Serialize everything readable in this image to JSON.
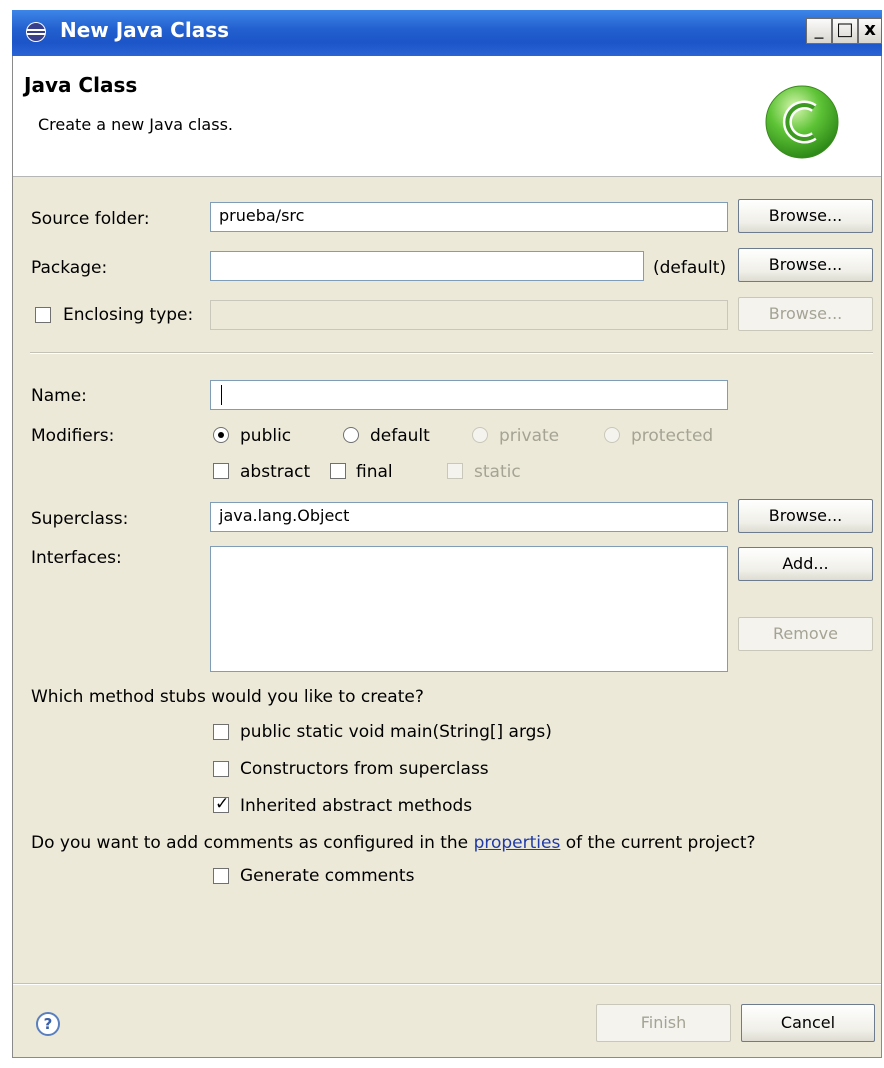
{
  "window": {
    "title": "New Java Class",
    "min": "_",
    "max": "□",
    "close": "x"
  },
  "header": {
    "title": "Java Class",
    "description": "Create a new Java class."
  },
  "form": {
    "source_folder_label": "Source folder:",
    "source_folder_value": "prueba/src",
    "package_label": "Package:",
    "package_value": "",
    "package_default": "(default)",
    "enclosing_label": "Enclosing type:",
    "enclosing_value": "",
    "browse_label": "Browse...",
    "name_label": "Name:",
    "name_value": "",
    "modifiers_label": "Modifiers:",
    "modifiers": {
      "public": "public",
      "default": "default",
      "private": "private",
      "protected": "protected",
      "abstract": "abstract",
      "final": "final",
      "static": "static",
      "selected": "public"
    },
    "superclass_label": "Superclass:",
    "superclass_value": "java.lang.Object",
    "interfaces_label": "Interfaces:",
    "add_label": "Add...",
    "remove_label": "Remove",
    "stubs_question": "Which method stubs would you like to create?",
    "stubs": [
      {
        "label": "public static void main(String[] args)",
        "checked": false
      },
      {
        "label": "Constructors from superclass",
        "checked": false
      },
      {
        "label": "Inherited abstract methods",
        "checked": true
      }
    ],
    "comments_question_prefix": "Do you want to add comments as configured in the ",
    "comments_link": "properties",
    "comments_question_suffix": " of the current project?",
    "generate_comments": {
      "label": "Generate comments",
      "checked": false
    }
  },
  "footer": {
    "help": "?",
    "finish_label": "Finish",
    "cancel_label": "Cancel"
  }
}
